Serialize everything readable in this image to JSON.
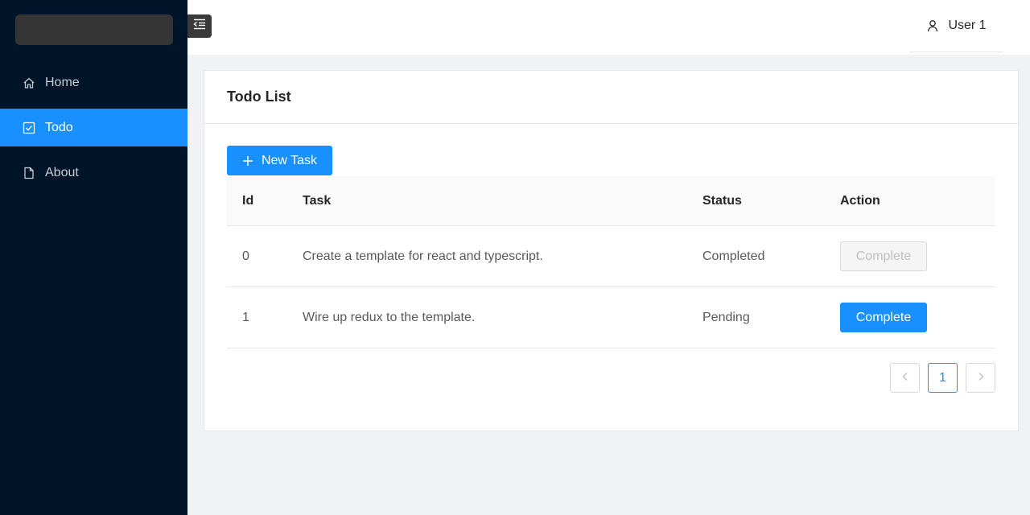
{
  "sidebar": {
    "items": [
      {
        "label": "Home",
        "icon": "home-icon"
      },
      {
        "label": "Todo",
        "icon": "checkbox-icon",
        "active": true
      },
      {
        "label": "About",
        "icon": "file-icon"
      }
    ]
  },
  "header": {
    "user_label": "User 1"
  },
  "card": {
    "title": "Todo List",
    "new_task_label": "New Task"
  },
  "table": {
    "headers": [
      "Id",
      "Task",
      "Status",
      "Action"
    ],
    "rows": [
      {
        "id": "0",
        "task": "Create a template for react and typescript.",
        "status": "Completed",
        "action": "Complete",
        "disabled": true
      },
      {
        "id": "1",
        "task": "Wire up redux to the template.",
        "status": "Pending",
        "action": "Complete",
        "disabled": false
      }
    ]
  },
  "pagination": {
    "current_page": "1"
  },
  "colors": {
    "sidebar_bg": "#001529",
    "accent": "#1890ff",
    "page_bg": "#f0f2f5"
  }
}
